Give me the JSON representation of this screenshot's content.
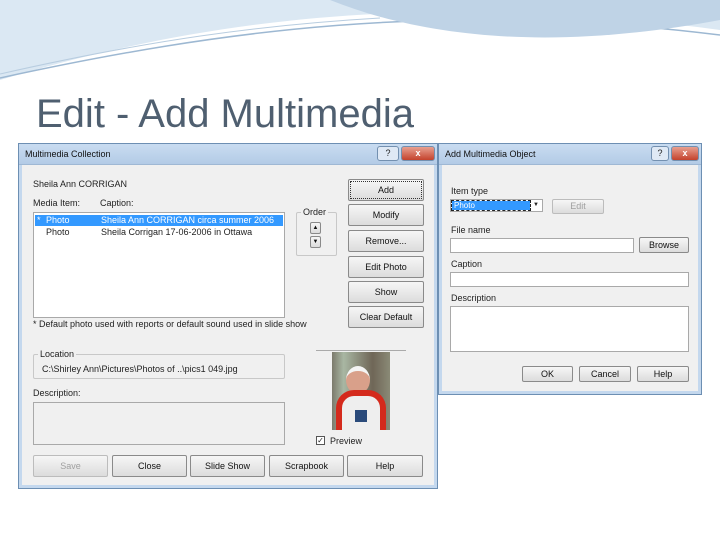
{
  "slide": {
    "title": "Edit - Add Multimedia",
    "accent": "#c4d8ee"
  },
  "collection": {
    "title": "Multimedia Collection",
    "person": "Sheila Ann CORRIGAN",
    "col_media": "Media Item:",
    "col_caption": "Caption:",
    "rows": [
      {
        "mark": "*",
        "media": "Photo",
        "caption": "Sheila Ann CORRIGAN circa summer 2006",
        "selected": true
      },
      {
        "mark": "",
        "media": "Photo",
        "caption": "Sheila Corrigan 17-06-2006 in Ottawa",
        "selected": false
      }
    ],
    "order_label": "Order",
    "buttons": {
      "add": "Add",
      "modify": "Modify",
      "remove": "Remove...",
      "edit_photo": "Edit Photo",
      "show": "Show",
      "clear_default": "Clear Default"
    },
    "footnote": "* Default photo used with reports or default sound used in slide show",
    "location_label": "Location",
    "location_value": "C:\\Shirley Ann\\Pictures\\Photos of ..\\pics1 049.jpg",
    "description_label": "Description:",
    "preview_label": "Preview",
    "preview_checked": true,
    "bottom": {
      "save": "Save",
      "close": "Close",
      "slide_show": "Slide Show",
      "scrapbook": "Scrapbook",
      "help": "Help"
    },
    "help_glyph": "?",
    "close_glyph": "x"
  },
  "add_object": {
    "title": "Add Multimedia Object",
    "item_type_label": "Item type",
    "item_type_value": "Photo",
    "edit": "Edit",
    "file_name_label": "File name",
    "browse": "Browse",
    "caption_label": "Caption",
    "description_label": "Description",
    "ok": "OK",
    "cancel": "Cancel",
    "help": "Help",
    "help_glyph": "?",
    "close_glyph": "x"
  }
}
